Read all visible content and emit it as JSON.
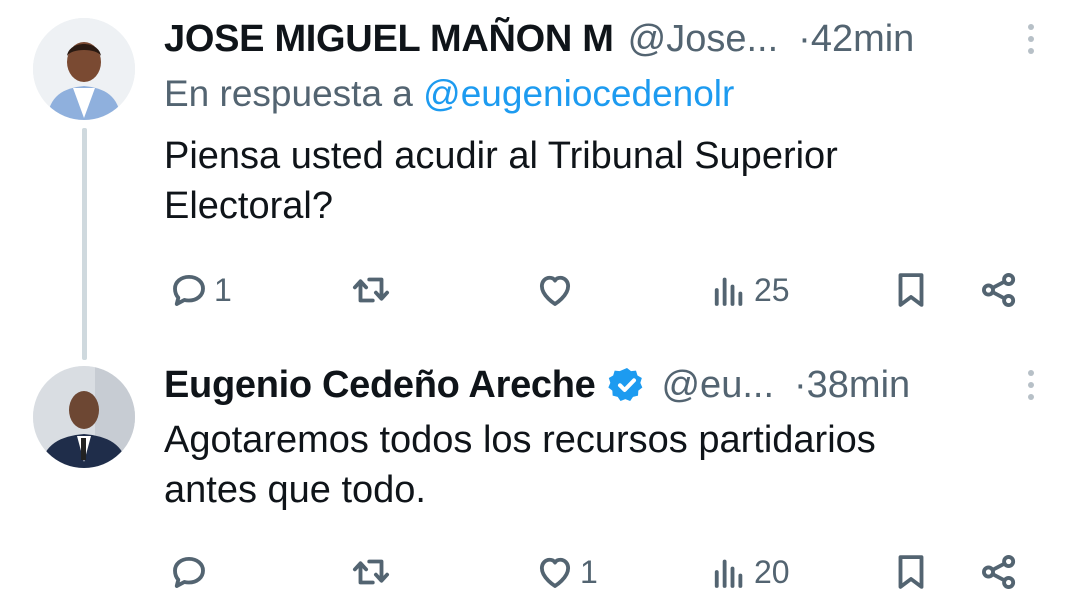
{
  "tweets": [
    {
      "author_name": "JOSE MIGUEL MAÑON M",
      "handle": "@Jose...",
      "separator": "·",
      "time": "42min",
      "reply_prefix": "En respuesta a",
      "reply_mention": "@eugeniocedenolr",
      "text_line1": "Piensa usted acudir al Tribunal Superior",
      "text_line2": "Electoral?",
      "verified": false,
      "stats": {
        "replies": "1",
        "retweets": "",
        "likes": "",
        "views": "25"
      }
    },
    {
      "author_name": "Eugenio Cedeño Areche",
      "handle": "@eu...",
      "separator": "·",
      "time": "38min",
      "text_line1": "Agotaremos todos los recursos partidarios",
      "text_line2": "antes que todo.",
      "verified": true,
      "stats": {
        "replies": "",
        "retweets": "",
        "likes": "1",
        "views": "20"
      }
    }
  ],
  "icons": {
    "reply": "reply-icon",
    "retweet": "retweet-icon",
    "like": "heart-icon",
    "views": "views-icon",
    "bookmark": "bookmark-icon",
    "share": "share-icon",
    "more": "more-options-icon",
    "verified": "verified-badge-icon"
  },
  "colors": {
    "link": "#1d9bf0",
    "muted": "#536471",
    "text": "#0f1419",
    "thread": "#cfd9de"
  }
}
